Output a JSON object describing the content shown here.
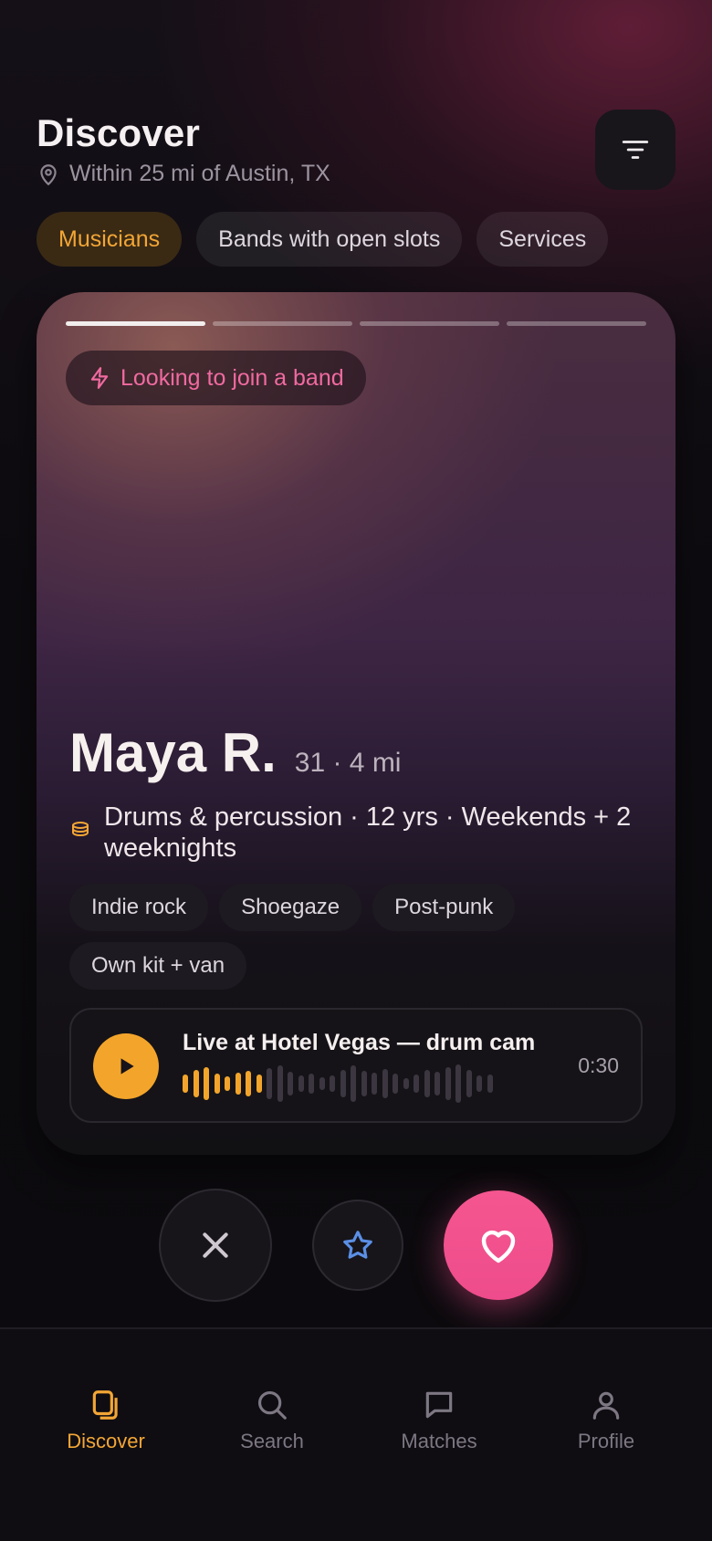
{
  "header": {
    "title": "Discover",
    "location": "Within 25 mi of Austin, TX"
  },
  "chips": [
    {
      "label": "Musicians",
      "active": true
    },
    {
      "label": "Bands with open slots",
      "active": false
    },
    {
      "label": "Services",
      "active": false
    }
  ],
  "card": {
    "photo_index": 1,
    "photo_count": 4,
    "status": "Looking to join a band",
    "name": "Maya R.",
    "meta": "31 · 4 mi",
    "instrument": "Drums & percussion · 12 yrs · Weekends + 2 weeknights",
    "tags": [
      "Indie rock",
      "Shoegaze",
      "Post-punk",
      "Own kit + van"
    ],
    "audio": {
      "title": "Live at Hotel Vegas — drum cam",
      "time": "0:30",
      "progress": 0.27
    }
  },
  "actions": {
    "pass": "close-icon",
    "super_like": "star-icon",
    "like": "heart-icon"
  },
  "nav": [
    {
      "label": "Discover",
      "icon": "cards-icon",
      "active": true
    },
    {
      "label": "Search",
      "icon": "search-icon",
      "active": false
    },
    {
      "label": "Matches",
      "icon": "chat-icon",
      "active": false
    },
    {
      "label": "Profile",
      "icon": "person-icon",
      "active": false
    }
  ],
  "colors": {
    "accent": "#f3a635",
    "like": "#f04f8d",
    "status": "#f06aa0",
    "super_like": "#5b8fe6"
  }
}
